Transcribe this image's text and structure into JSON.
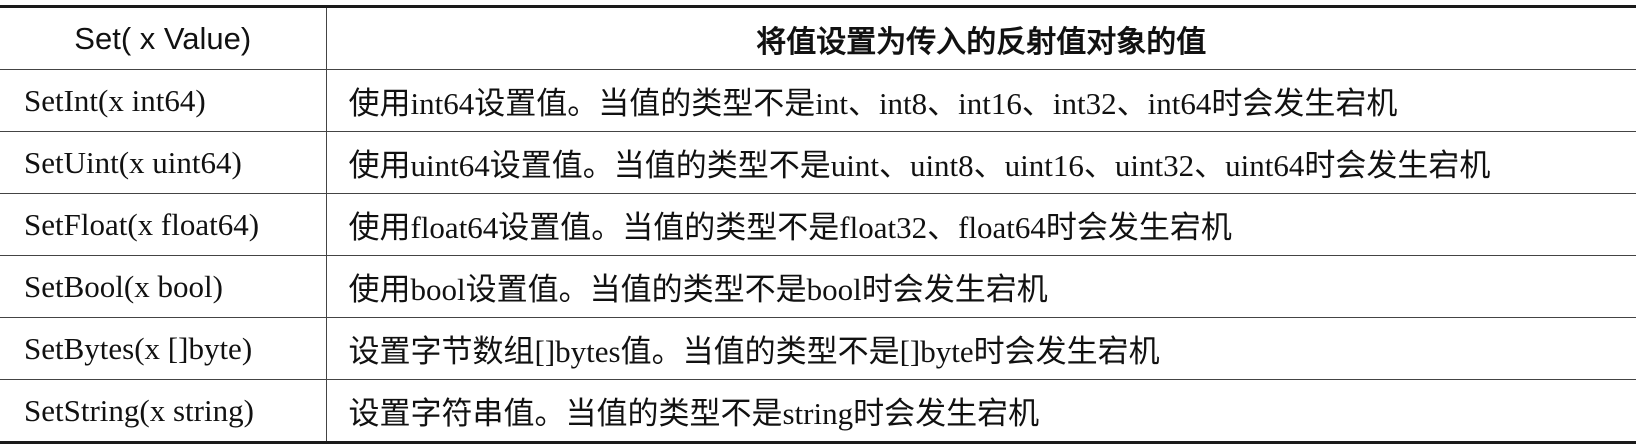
{
  "table": {
    "headers": [
      "Set( x Value)",
      "将值设置为传入的反射值对象的值"
    ],
    "rows": [
      {
        "method": "SetInt(x int64)",
        "description": "使用int64设置值。当值的类型不是int、int8、int16、int32、int64时会发生宕机"
      },
      {
        "method": "SetUint(x uint64)",
        "description": "使用uint64设置值。当值的类型不是uint、uint8、uint16、uint32、uint64时会发生宕机"
      },
      {
        "method": "SetFloat(x float64)",
        "description": "使用float64设置值。当值的类型不是float32、float64时会发生宕机"
      },
      {
        "method": "SetBool(x bool)",
        "description": "使用bool设置值。当值的类型不是bool时会发生宕机"
      },
      {
        "method": "SetBytes(x []byte)",
        "description": "设置字节数组[]bytes值。当值的类型不是[]byte时会发生宕机"
      },
      {
        "method": "SetString(x string)",
        "description": "设置字符串值。当值的类型不是string时会发生宕机"
      }
    ]
  }
}
